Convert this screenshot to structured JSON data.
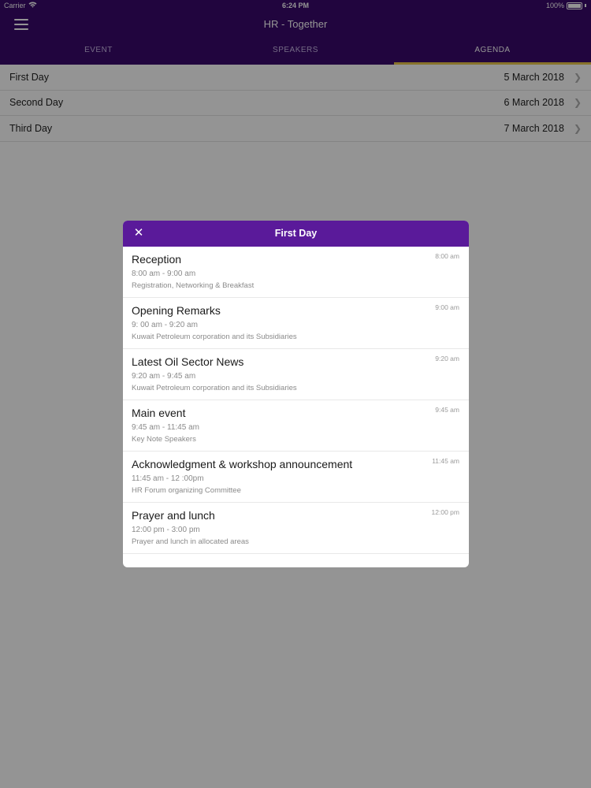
{
  "status": {
    "carrier": "Carrier",
    "time": "6:24 PM",
    "battery": "100%"
  },
  "header": {
    "title": "HR - Together"
  },
  "tabs": [
    {
      "label": "EVENT"
    },
    {
      "label": "SPEAKERS"
    },
    {
      "label": "AGENDA"
    }
  ],
  "days": [
    {
      "label": "First Day",
      "date": "5 March 2018"
    },
    {
      "label": "Second Day",
      "date": "6 March 2018"
    },
    {
      "label": "Third Day",
      "date": "7 March 2018"
    }
  ],
  "modal": {
    "title": "First Day",
    "items": [
      {
        "title": "Reception",
        "range": "8:00 am - 9:00 am",
        "desc": "Registration, Networking & Breakfast",
        "time": "8:00 am"
      },
      {
        "title": "Opening Remarks",
        "range": "9: 00 am - 9:20 am",
        "desc": "Kuwait Petroleum corporation and its Subsidiaries",
        "time": "9:00 am"
      },
      {
        "title": "Latest Oil Sector News",
        "range": "9:20 am - 9:45 am",
        "desc": "Kuwait Petroleum corporation and its Subsidiaries",
        "time": "9:20 am"
      },
      {
        "title": "Main event",
        "range": "9:45 am - 11:45 am",
        "desc": "Key Note Speakers",
        "time": "9:45 am"
      },
      {
        "title": "Acknowledgment & workshop announcement",
        "range": "11:45 am - 12 :00pm",
        "desc": "HR Forum organizing Committee",
        "time": "11:45 am"
      },
      {
        "title": "Prayer and lunch",
        "range": "12:00 pm - 3:00 pm",
        "desc": "Prayer and lunch in allocated areas",
        "time": "12:00 pm"
      }
    ]
  },
  "colors": {
    "header_bg": "#3a0a6b",
    "modal_header_bg": "#5a1a9a",
    "tab_indicator": "#e8c44a"
  }
}
